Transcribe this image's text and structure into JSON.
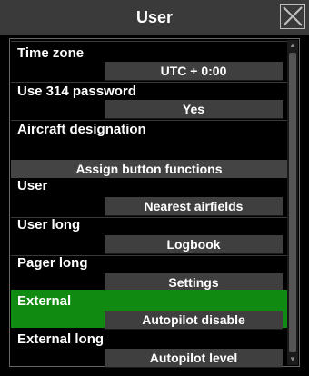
{
  "window": {
    "title": "User"
  },
  "rows": [
    {
      "label": "Time zone",
      "value": "UTC + 0:00"
    },
    {
      "label": "Use 314 password",
      "value": "Yes"
    },
    {
      "label": "Aircraft designation",
      "value": ""
    }
  ],
  "section": {
    "label": "Assign button functions"
  },
  "assignments": [
    {
      "label": "User",
      "value": "Nearest airfields"
    },
    {
      "label": "User long",
      "value": "Logbook"
    },
    {
      "label": "Pager long",
      "value": "Settings"
    },
    {
      "label": "External",
      "value": "Autopilot disable",
      "selected": true
    },
    {
      "label": "External long",
      "value": "Autopilot level"
    }
  ],
  "colors": {
    "selected_row": "#118a11",
    "title_bar": "#3a3a3a",
    "value_box": "#3f3f3f"
  },
  "icons": {
    "close": "close-x-icon",
    "scroll_up": "scroll-up-icon",
    "scroll_down": "scroll-down-icon"
  }
}
